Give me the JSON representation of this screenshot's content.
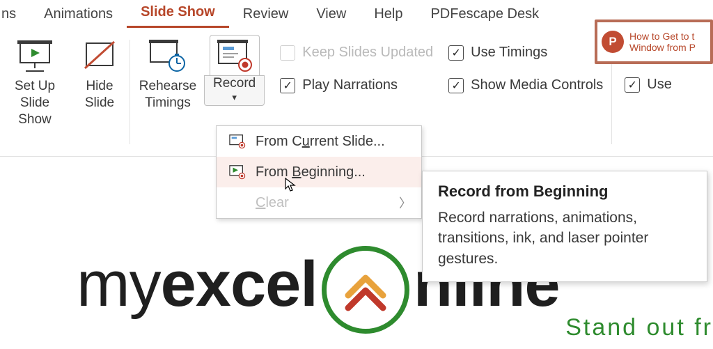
{
  "tabs": {
    "partial_left": "ns",
    "animations": "Animations",
    "slideshow": "Slide Show",
    "review": "Review",
    "view": "View",
    "help": "Help",
    "pdfescape": "PDFescape Desk"
  },
  "ribbon": {
    "setup": {
      "line1": "Set Up",
      "line2": "Slide Show"
    },
    "hide": {
      "line1": "Hide",
      "line2": "Slide"
    },
    "rehearse": {
      "line1": "Rehearse",
      "line2": "Timings"
    },
    "record": {
      "label": "Record"
    },
    "checks": {
      "keep_updated": "Keep Slides Updated",
      "play_narrations": "Play Narrations",
      "use_timings": "Use Timings",
      "show_media": "Show Media Controls",
      "use_presenter_partial": "Use"
    }
  },
  "menu": {
    "from_current": {
      "pre": "From C",
      "u": "u",
      "post": "rrent Slide..."
    },
    "from_beginning": {
      "pre": "From ",
      "u": "B",
      "post": "eginning..."
    },
    "clear": {
      "u": "C",
      "post": "lear"
    }
  },
  "tooltip": {
    "title": "Record from Beginning",
    "body": "Record narrations, animations, transitions, ink, and laser pointer gestures."
  },
  "related": {
    "line1": "How to Get to t",
    "line2": "Window from P"
  },
  "brand": {
    "my": "my",
    "excel": "excel",
    "nline_partial": "nline",
    "tagline": "Stand out fr"
  }
}
